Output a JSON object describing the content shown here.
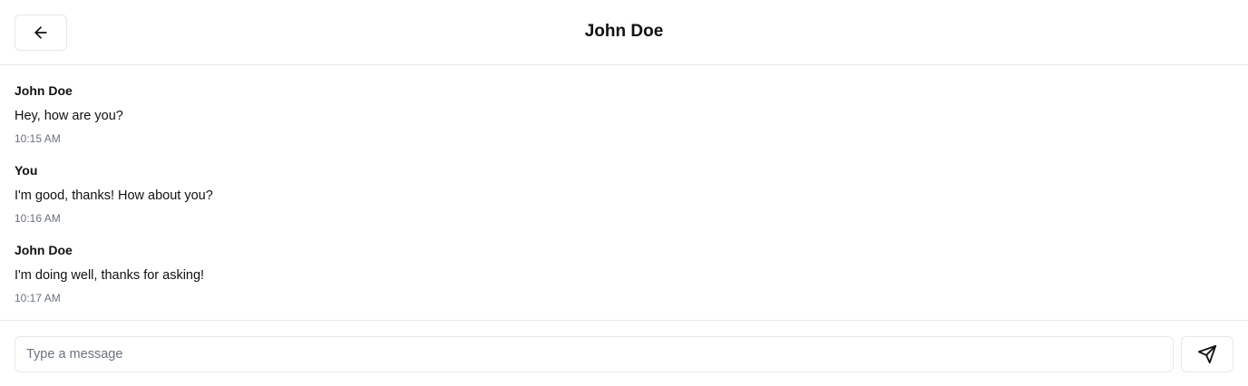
{
  "header": {
    "title": "John Doe",
    "back_icon": "arrow-left-icon"
  },
  "messages": [
    {
      "sender": "John Doe",
      "text": "Hey, how are you?",
      "time": "10:15 AM"
    },
    {
      "sender": "You",
      "text": "I'm good, thanks! How about you?",
      "time": "10:16 AM"
    },
    {
      "sender": "John Doe",
      "text": "I'm doing well, thanks for asking!",
      "time": "10:17 AM"
    }
  ],
  "composer": {
    "placeholder": "Type a message",
    "value": "",
    "send_icon": "send-icon"
  },
  "colors": {
    "border": "#e5e7eb",
    "text": "#111111",
    "muted": "#6b7280"
  }
}
